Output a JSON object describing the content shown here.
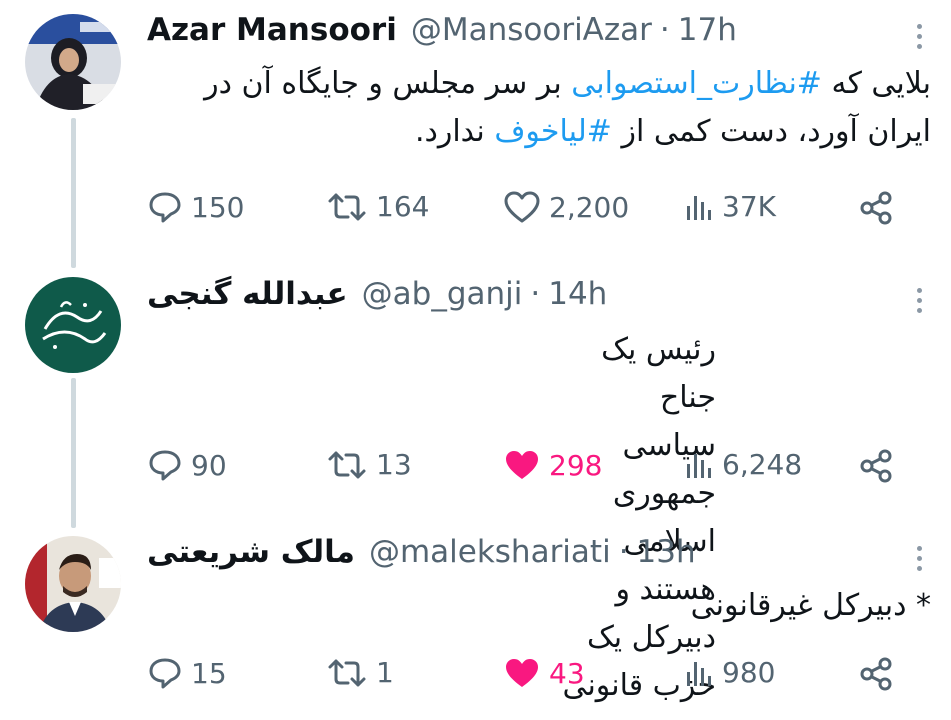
{
  "tweets": [
    {
      "name": "Azar Mansoori",
      "handle": "@MansooriAzar",
      "time": "17h",
      "text_parts": [
        {
          "t": "بلایی که ",
          "tag": false
        },
        {
          "t": "#نظارت_استصوابی",
          "tag": true
        },
        {
          "t": " بر سر مجلس و جایگاه آن در ایران آورد، دست کمی از ",
          "tag": false
        },
        {
          "t": "#لیاخوف",
          "tag": true
        },
        {
          "t": " ندارد.",
          "tag": false
        }
      ],
      "replies": "150",
      "retweets": "164",
      "likes": "2,200",
      "views": "37K",
      "liked": false
    },
    {
      "name": "عبدالله گنجی",
      "handle": "@ab_ganji",
      "time": "14h",
      "text_parts": [
        {
          "t": "رئیس یک جناح سیاسی جمهوری اسلامی هستند و دبیرکل یک حزب قانونی",
          "tag": false
        }
      ],
      "replies": "90",
      "retweets": "13",
      "likes": "298",
      "views": "6,248",
      "liked": true
    },
    {
      "name": "مالک شریعتی",
      "handle": "@malekshariati",
      "time": "13h",
      "text_parts": [
        {
          "t": "* دبیرکل غیرقانونی",
          "tag": false
        }
      ],
      "replies": "15",
      "retweets": "1",
      "likes": "43",
      "views": "980",
      "liked": true
    }
  ],
  "separator": "·",
  "icons": {
    "reply": "reply-icon",
    "retweet": "retweet-icon",
    "like": "heart-icon",
    "views": "views-icon",
    "share": "share-icon",
    "more": "more-vertical-icon"
  },
  "colors": {
    "accent": "#1d9bf0",
    "like": "#f91880",
    "muted": "#536471",
    "thread_line": "#cfd9de"
  }
}
